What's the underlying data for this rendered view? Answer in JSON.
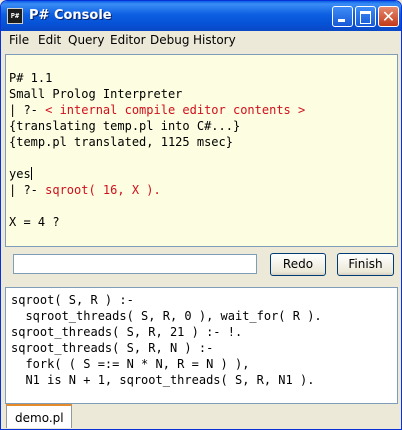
{
  "window": {
    "title": "P# Console",
    "icon_label": "P#"
  },
  "menu": {
    "items": [
      "File",
      "Edit",
      "Query",
      "Editor",
      "Debug",
      "History"
    ]
  },
  "console": {
    "lines": [
      {
        "text": "P# 1.1",
        "color": "#000000"
      },
      {
        "text": "Small Prolog Interpreter",
        "color": "#000000"
      },
      {
        "prefix": "| ?- ",
        "text": "< internal compile editor contents >",
        "color": "#d0101c"
      },
      {
        "text": "{translating temp.pl into C#...}",
        "color": "#000000"
      },
      {
        "text": "{temp.pl translated, 1125 msec}",
        "color": "#000000"
      },
      {
        "text": "",
        "color": "#000000"
      },
      {
        "text": "yes",
        "color": "#000000"
      },
      {
        "prefix": "| ?- ",
        "text": "sqroot( 16, X ).",
        "color": "#d0101c"
      },
      {
        "text": "",
        "color": "#000000"
      },
      {
        "text": "X = 4 ?",
        "color": "#000000"
      }
    ]
  },
  "query_bar": {
    "input_value": "",
    "redo_label": "Redo",
    "finish_label": "Finish"
  },
  "editor": {
    "lines": [
      "sqroot( S, R ) :-",
      "  sqroot_threads( S, R, 0 ), wait_for( R ).",
      "sqroot_threads( S, R, 21 ) :- !.",
      "sqroot_threads( S, R, N ) :-",
      "  fork( ( S =:= N * N, R = N ) ),",
      "  N1 is N + 1, sqroot_threads( S, R, N1 )."
    ]
  },
  "tabs": {
    "active": "demo.pl"
  }
}
